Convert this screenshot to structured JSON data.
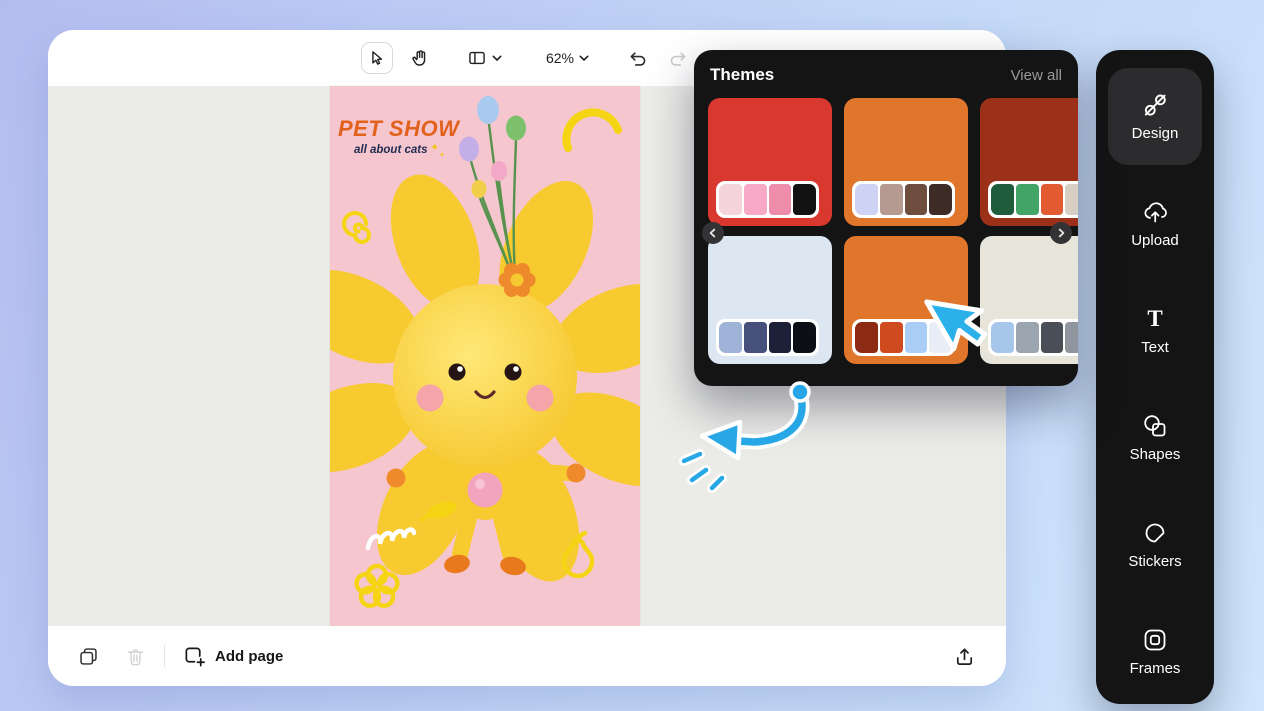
{
  "toolbar": {
    "zoom_value": "62%",
    "icons": [
      "select-cursor-icon",
      "hand-icon",
      "layout-icon",
      "chevron-down-icon",
      "undo-icon",
      "redo-icon"
    ]
  },
  "bottom_bar": {
    "add_page_label": "Add page",
    "icons": [
      "duplicate-page-icon",
      "trash-icon",
      "add-page-icon",
      "export-icon"
    ]
  },
  "poster": {
    "title": "PET SHOW",
    "subtitle": "all about cats"
  },
  "themes": {
    "title": "Themes",
    "view_all": "View all",
    "cards": [
      {
        "bg": "#d8382e",
        "swatches": [
          "#f6d4db",
          "#f7a9c6",
          "#ee8cab",
          "#121212"
        ]
      },
      {
        "bg": "#e0752c",
        "swatches": [
          "#ced3f4",
          "#b59a92",
          "#6e4c3e",
          "#3c2c25"
        ]
      },
      {
        "bg": "#9c3018",
        "swatches": [
          "#1f5c3c",
          "#43a467",
          "#e25b33",
          "#d8cfc4"
        ]
      },
      {
        "bg": "#dde7f1",
        "swatches": [
          "#9fb3d9",
          "#46507a",
          "#1b2038",
          "#0d0f16"
        ]
      },
      {
        "bg": "#e0752c",
        "swatches": [
          "#8c2a14",
          "#cf4a1f",
          "#aacdf5",
          "#e9eef6"
        ]
      },
      {
        "bg": "#e7e4da",
        "swatches": [
          "#a6c6ea",
          "#9aa5b0",
          "#4a4f57",
          "#8f969e"
        ]
      }
    ]
  },
  "sidebar": {
    "items": [
      {
        "label": "Design",
        "icon": "design-icon",
        "active": true
      },
      {
        "label": "Upload",
        "icon": "upload-icon",
        "active": false
      },
      {
        "label": "Text",
        "icon": "text-icon",
        "active": false
      },
      {
        "label": "Shapes",
        "icon": "shapes-icon",
        "active": false
      },
      {
        "label": "Stickers",
        "icon": "stickers-icon",
        "active": false
      },
      {
        "label": "Frames",
        "icon": "frames-icon",
        "active": false
      }
    ]
  },
  "colors": {
    "annotation_blue": "#27a7e6",
    "panel_bg": "#141414",
    "canvas_bg": "#ebebe8",
    "poster_bg": "#f6c6cf",
    "poster_title": "#e2611c"
  }
}
